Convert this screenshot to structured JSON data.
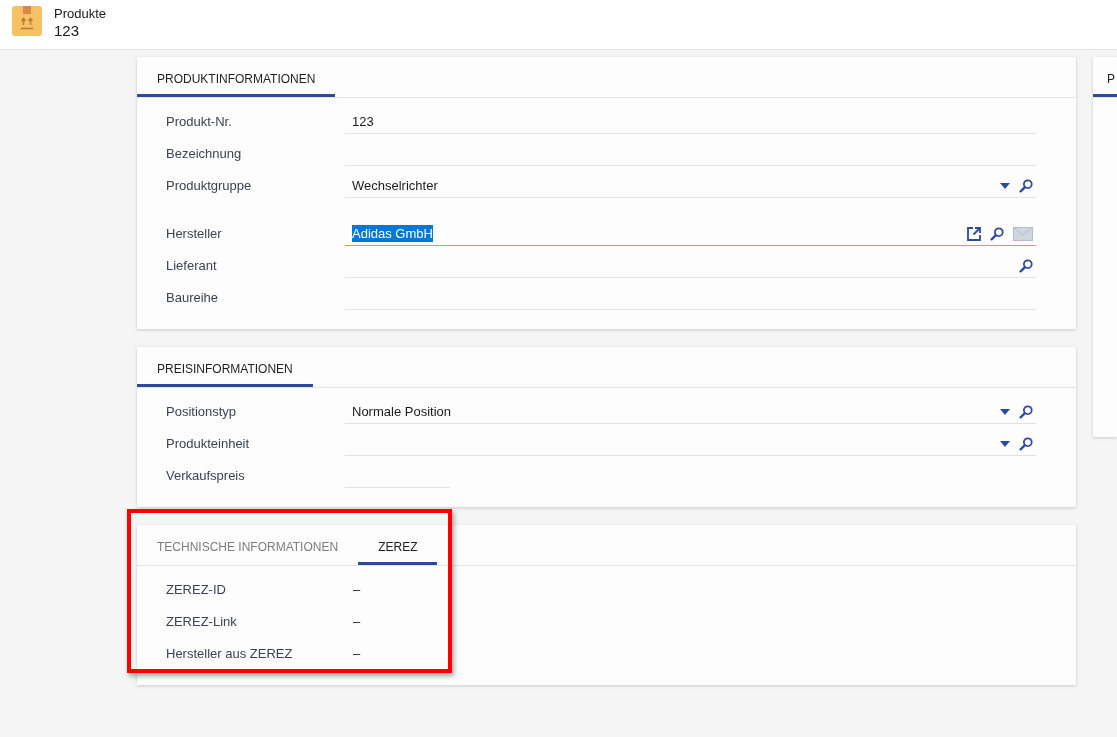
{
  "header": {
    "title": "Produkte",
    "subtitle": "123"
  },
  "sections": [
    {
      "tabs": [
        {
          "label": "PRODUKTINFORMATIONEN",
          "selected": true
        }
      ],
      "highlighted": false,
      "field_groups": [
        [
          {
            "label": "Produkt-Nr.",
            "kind": "input",
            "value": "123",
            "focused": false,
            "value_selected": false
          },
          {
            "label": "Bezeichnung",
            "kind": "input",
            "focused": false
          },
          {
            "label": "Produktgruppe",
            "kind": "input",
            "value": "Wechselrichter",
            "focused": false,
            "value_selected": false,
            "actions": [
              {
                "kind": "dropdown",
                "disabled": false
              },
              {
                "kind": "search",
                "disabled": false
              }
            ]
          }
        ],
        [
          {
            "label": "Hersteller",
            "kind": "input",
            "value": "Adidas GmbH",
            "focused": true,
            "value_selected": true,
            "actions": [
              {
                "kind": "open",
                "disabled": false
              },
              {
                "kind": "search",
                "disabled": false
              },
              {
                "kind": "mail",
                "disabled": true
              }
            ]
          },
          {
            "label": "Lieferant",
            "kind": "input",
            "focused": false,
            "actions": [
              {
                "kind": "search",
                "disabled": false
              }
            ]
          },
          {
            "label": "Baureihe",
            "kind": "input",
            "focused": false
          }
        ]
      ]
    },
    {
      "tabs": [
        {
          "label": "PREISINFORMATIONEN",
          "selected": true
        }
      ],
      "highlighted": false,
      "field_groups": [
        [
          {
            "label": "Positionstyp",
            "kind": "input",
            "value": "Normale Position",
            "focused": false,
            "value_selected": false,
            "actions": [
              {
                "kind": "dropdown",
                "disabled": false
              },
              {
                "kind": "search",
                "disabled": false
              }
            ]
          },
          {
            "label": "Produkteinheit",
            "kind": "input",
            "focused": false,
            "actions": [
              {
                "kind": "dropdown",
                "disabled": false
              },
              {
                "kind": "search",
                "disabled": false
              }
            ]
          },
          {
            "label": "Verkaufspreis",
            "kind": "number",
            "focused": false
          }
        ]
      ]
    },
    {
      "tabs": [
        {
          "label": "TECHNISCHE INFORMATIONEN",
          "selected": false
        },
        {
          "label": "ZEREZ",
          "selected": true
        }
      ],
      "highlighted": true,
      "field_groups": [
        [
          {
            "label": "ZEREZ-ID",
            "kind": "display",
            "value": "–"
          },
          {
            "label": "ZEREZ-Link",
            "kind": "display",
            "value": "–"
          },
          {
            "label": "Hersteller aus ZEREZ",
            "kind": "display",
            "value": "–"
          }
        ]
      ]
    }
  ],
  "side_panel": {
    "tabs": [
      {
        "label": "P",
        "selected": true
      }
    ]
  }
}
